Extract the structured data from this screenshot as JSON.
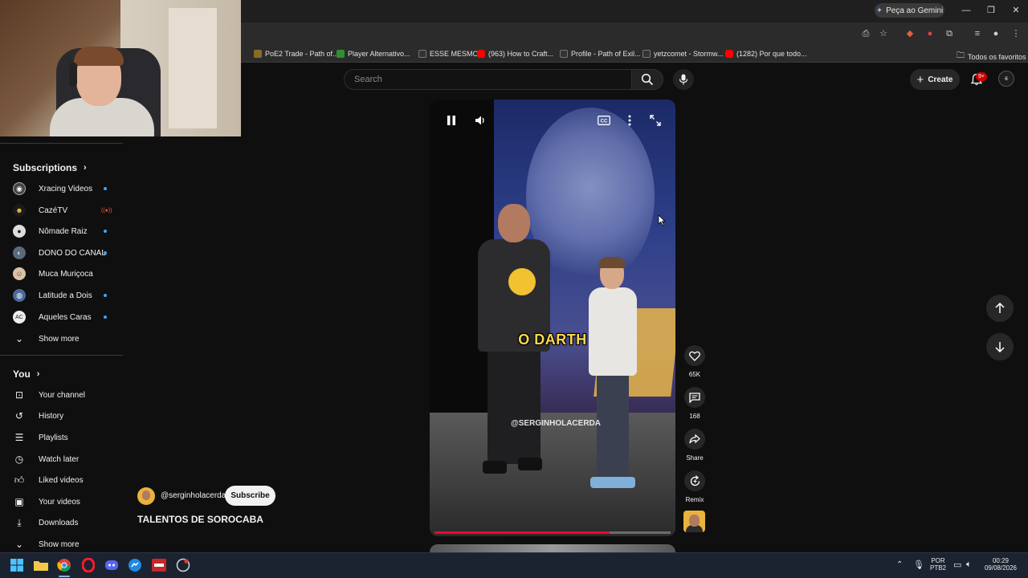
{
  "browser": {
    "gemini_label": "Peça ao Gemini",
    "bookmarks": [
      {
        "label": "PoE2 Trade - Path of...",
        "color": "#8a6a2a"
      },
      {
        "label": "Player Alternativo...",
        "color": "#2f8f2f"
      },
      {
        "label": "ESSE MESMO",
        "color": "#333333"
      },
      {
        "label": "(963) How to Craft...",
        "color": "#ff0000"
      },
      {
        "label": "Profile - Path of Exil...",
        "color": "#333333"
      },
      {
        "label": "yetzcomet - Stormw...",
        "color": "#333333"
      },
      {
        "label": "(1282) Por que todo...",
        "color": "#ff0000"
      }
    ],
    "all_bookmarks": "Todos os favoritos"
  },
  "sidebar": {
    "subscriptions_title": "Subscriptions",
    "subscriptions": [
      {
        "label": "Xracing Videos",
        "indicator": "dot",
        "icon_bg": "#444444"
      },
      {
        "label": "CazéTV",
        "indicator": "live",
        "icon_bg": "#1a1a1a"
      },
      {
        "label": "Nômade Raiz",
        "indicator": "dot",
        "icon_bg": "#dddddd"
      },
      {
        "label": "DONO DO CANAL",
        "indicator": "dot",
        "icon_bg": "#5a6a7a"
      },
      {
        "label": "Muca Muriçoca",
        "indicator": "none",
        "icon_bg": "#d9c2a8"
      },
      {
        "label": "Latitude a Dois",
        "indicator": "dot",
        "icon_bg": "#4a6a9a"
      },
      {
        "label": "Aqueles Caras",
        "indicator": "dot",
        "icon_bg": "#eeeeee"
      }
    ],
    "subs_show_more": "Show more",
    "you_title": "You",
    "you_items": [
      {
        "label": "Your channel",
        "icon": "channel-icon"
      },
      {
        "label": "History",
        "icon": "history-icon"
      },
      {
        "label": "Playlists",
        "icon": "playlists-icon"
      },
      {
        "label": "Watch later",
        "icon": "watch-later-icon"
      },
      {
        "label": "Liked videos",
        "icon": "liked-icon"
      },
      {
        "label": "Your videos",
        "icon": "your-videos-icon"
      },
      {
        "label": "Downloads",
        "icon": "downloads-icon"
      }
    ],
    "you_show_more": "Show more"
  },
  "header": {
    "search_placeholder": "Search",
    "create_label": "Create",
    "notif_badge": "9+"
  },
  "short": {
    "caption": "O DARTH",
    "watermark": "@SERGINHOLACERDA",
    "progress": 0.74,
    "likes": "65K",
    "comments": "168",
    "share_label": "Share",
    "remix_label": "Remix"
  },
  "channel": {
    "handle": "@serginholacerda",
    "subscribe_label": "Subscribe",
    "video_title": "TALENTOS DE SOROCABA"
  },
  "taskbar": {
    "lang_line1": "POR",
    "lang_line2": "PTB2",
    "time": "00:29",
    "date": "09/08/2026"
  },
  "colors": {
    "accent_red": "#ff0033",
    "subscribe_bg": "#f1f1f1",
    "caption_yellow": "#ffd84a"
  }
}
